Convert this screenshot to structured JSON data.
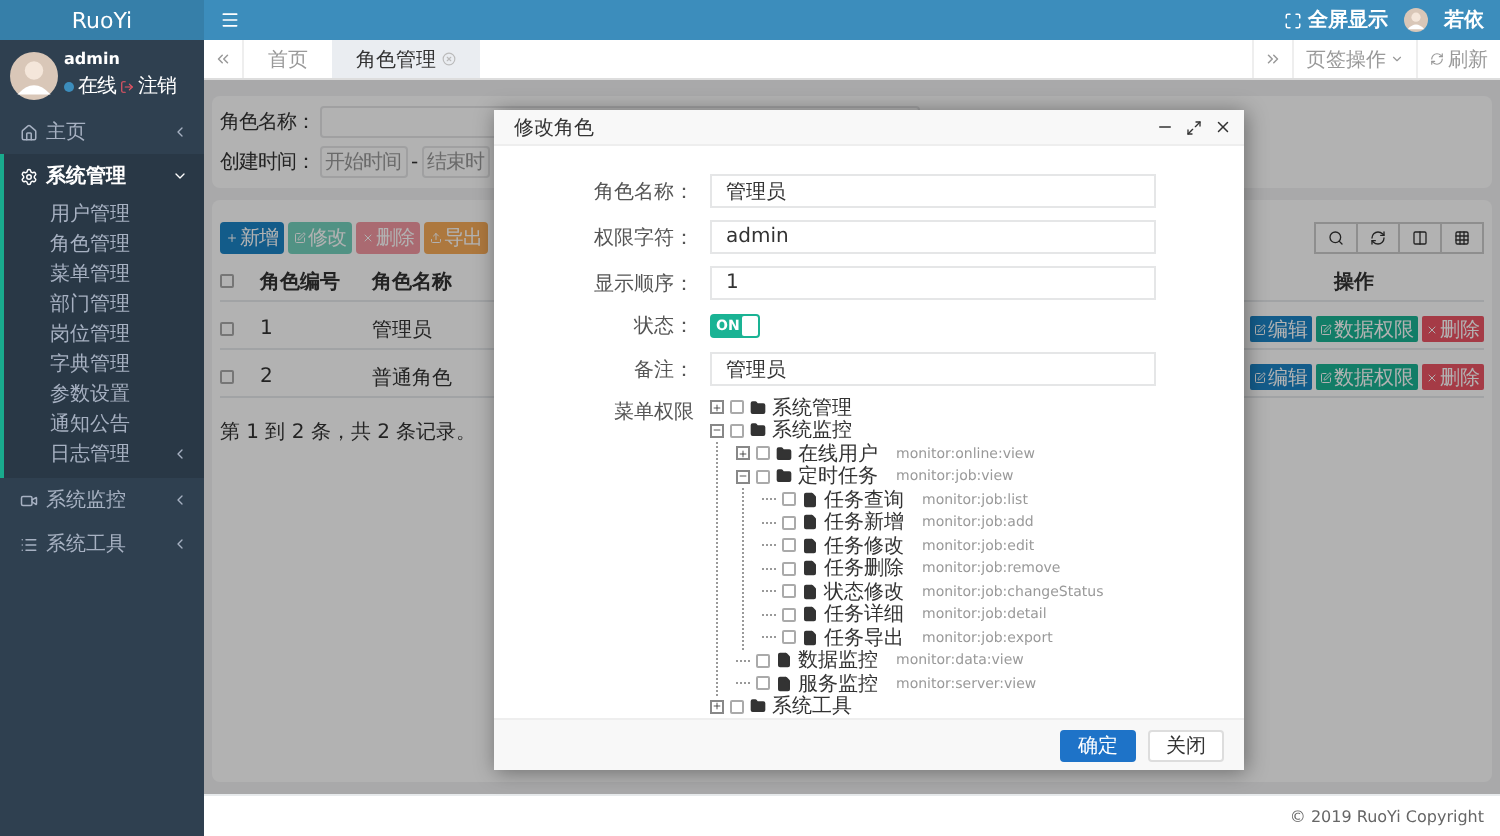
{
  "sidebar": {
    "logo": "RuoYi",
    "user": {
      "name": "admin",
      "status": "在线",
      "logout": "注销"
    },
    "menu": [
      {
        "label": "主页",
        "expanded": false
      },
      {
        "label": "系统管理",
        "expanded": true,
        "children": [
          {
            "label": "用户管理"
          },
          {
            "label": "角色管理"
          },
          {
            "label": "菜单管理"
          },
          {
            "label": "部门管理"
          },
          {
            "label": "岗位管理"
          },
          {
            "label": "字典管理"
          },
          {
            "label": "参数设置"
          },
          {
            "label": "通知公告"
          },
          {
            "label": "日志管理",
            "expanded": false
          }
        ]
      },
      {
        "label": "系统监控",
        "expanded": false
      },
      {
        "label": "系统工具",
        "expanded": false
      }
    ]
  },
  "header": {
    "fullscreen": "全屏显示",
    "user": "若依"
  },
  "tabs": {
    "items": [
      {
        "label": "首页",
        "selected": false
      },
      {
        "label": "角色管理",
        "selected": true
      }
    ],
    "tab_menu": "页签操作",
    "refresh": "刷新"
  },
  "search": {
    "role_name_label": "角色名称：",
    "created_label": "创建时间：",
    "start_placeholder": "开始时间",
    "separator": "-",
    "end_placeholder": "结束时"
  },
  "toolbar": {
    "buttons": [
      {
        "label": "新增",
        "kind": "add"
      },
      {
        "label": "修改",
        "kind": "edit"
      },
      {
        "label": "删除",
        "kind": "delete"
      },
      {
        "label": "导出",
        "kind": "export"
      }
    ]
  },
  "table": {
    "header_checked": false,
    "columns": [
      "角色编号",
      "角色名称",
      "操作"
    ],
    "rows": [
      {
        "checked": false,
        "id": "1",
        "name": "管理员",
        "actions": [
          {
            "label": "编辑",
            "kind": "edit"
          },
          {
            "label": "数据权限",
            "kind": "data"
          },
          {
            "label": "删除",
            "kind": "delete"
          }
        ]
      },
      {
        "checked": false,
        "id": "2",
        "name": "普通角色",
        "actions": [
          {
            "label": "编辑",
            "kind": "edit"
          },
          {
            "label": "数据权限",
            "kind": "data"
          },
          {
            "label": "删除",
            "kind": "delete"
          }
        ]
      }
    ],
    "summary": "第 1 到 2 条，共 2 条记录。"
  },
  "dialog": {
    "title": "修改角色",
    "fields": [
      {
        "kind": "text",
        "label": "角色名称：",
        "value": "管理员"
      },
      {
        "kind": "text",
        "label": "权限字符：",
        "value": "admin"
      },
      {
        "kind": "text",
        "label": "显示顺序：",
        "value": "1"
      },
      {
        "kind": "switch",
        "label": "状态：",
        "on": true,
        "text": "ON"
      },
      {
        "kind": "text",
        "label": "备注：",
        "value": "管理员"
      },
      {
        "kind": "tree",
        "label": "菜单权限",
        "tree": [
          {
            "label": "系统管理",
            "checked": false,
            "expanded": false
          },
          {
            "label": "系统监控",
            "checked": false,
            "expanded": true,
            "children": [
              {
                "label": "在线用户",
                "perm": "monitor:online:view",
                "checked": false,
                "expanded": false
              },
              {
                "label": "定时任务",
                "perm": "monitor:job:view",
                "checked": false,
                "expanded": true,
                "children": [
                  {
                    "label": "任务查询",
                    "perm": "monitor:job:list",
                    "checked": false
                  },
                  {
                    "label": "任务新增",
                    "perm": "monitor:job:add",
                    "checked": false
                  },
                  {
                    "label": "任务修改",
                    "perm": "monitor:job:edit",
                    "checked": false
                  },
                  {
                    "label": "任务删除",
                    "perm": "monitor:job:remove",
                    "checked": false
                  },
                  {
                    "label": "状态修改",
                    "perm": "monitor:job:changeStatus",
                    "checked": false
                  },
                  {
                    "label": "任务详细",
                    "perm": "monitor:job:detail",
                    "checked": false
                  },
                  {
                    "label": "任务导出",
                    "perm": "monitor:job:export",
                    "checked": false
                  }
                ]
              },
              {
                "label": "数据监控",
                "perm": "monitor:data:view",
                "checked": false
              },
              {
                "label": "服务监控",
                "perm": "monitor:server:view",
                "checked": false
              }
            ]
          },
          {
            "label": "系统工具",
            "checked": false,
            "expanded": false
          }
        ]
      }
    ],
    "buttons": [
      {
        "label": "确定",
        "kind": "primary"
      },
      {
        "label": "关闭",
        "kind": "default"
      }
    ]
  },
  "footer": "© 2019 RuoYi Copyright"
}
